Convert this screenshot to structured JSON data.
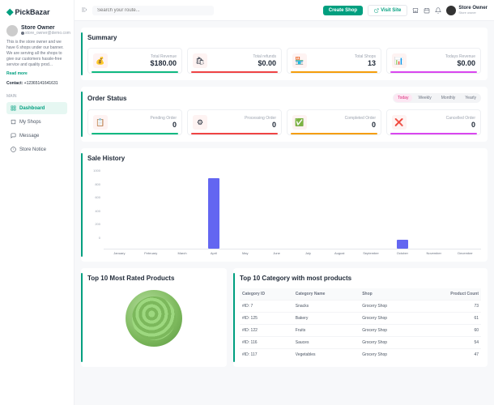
{
  "brand": "PickBazar",
  "search_placeholder": "Search your route...",
  "buttons": {
    "create": "Create Shop",
    "visit": "Visit Site"
  },
  "user": {
    "name": "Store Owner",
    "role": "Store owner"
  },
  "owner": {
    "name": "Store Owner",
    "email": "store_owner@demo.com",
    "bio": "This is the store owner and we have 6 shops under our banner. We are serving all the shops to give our customers hassle-free service and quality prod...",
    "readmore": "Read more",
    "contact_label": "Contact:",
    "contact": "+12365141641631"
  },
  "nav_label": "MAIN",
  "nav": [
    {
      "label": "Dashboard",
      "active": true
    },
    {
      "label": "My Shops"
    },
    {
      "label": "Message"
    },
    {
      "label": "Store Notice"
    }
  ],
  "summary": {
    "title": "Summary",
    "items": [
      {
        "label": "Total Revenue",
        "value": "$180.00",
        "icon": "💰"
      },
      {
        "label": "Total refunds",
        "value": "$0.00",
        "icon": "🛍"
      },
      {
        "label": "Total Shops",
        "value": "13",
        "icon": "🏪"
      },
      {
        "label": "Todays Revenue",
        "value": "$0.00",
        "icon": "📊"
      }
    ]
  },
  "order_status": {
    "title": "Order Status",
    "tabs": [
      "Today",
      "Weekly",
      "Monthly",
      "Yearly"
    ],
    "active_tab": 0,
    "items": [
      {
        "label": "Pending Order",
        "value": "0",
        "icon": "📋"
      },
      {
        "label": "Processing Order",
        "value": "0",
        "icon": "⚙"
      },
      {
        "label": "Completed Order",
        "value": "0",
        "icon": "✅"
      },
      {
        "label": "Cancelled Order",
        "value": "0",
        "icon": "❌"
      }
    ]
  },
  "chart_data": {
    "type": "bar",
    "title": "Sale History",
    "categories": [
      "January",
      "February",
      "March",
      "April",
      "May",
      "June",
      "July",
      "August",
      "September",
      "October",
      "November",
      "December"
    ],
    "values": [
      0,
      0,
      0,
      1000,
      0,
      0,
      0,
      0,
      0,
      120,
      0,
      0
    ],
    "ylim": [
      0,
      1000
    ],
    "yticks": [
      0,
      200,
      400,
      600,
      800,
      1000
    ],
    "xlabel": "",
    "ylabel": ""
  },
  "top_products": {
    "title": "Top 10 Most Rated Products"
  },
  "top_categories": {
    "title": "Top 10 Category with most products",
    "headers": [
      "Category ID",
      "Category Name",
      "Shop",
      "Product Count"
    ],
    "rows": [
      [
        "#ID: 7",
        "Snacks",
        "Grocery Shop",
        "73"
      ],
      [
        "#ID: 125",
        "Bakery",
        "Grocery Shop",
        "61"
      ],
      [
        "#ID: 122",
        "Fruits",
        "Grocery Shop",
        "60"
      ],
      [
        "#ID: 116",
        "Sauces",
        "Grocery Shop",
        "54"
      ],
      [
        "#ID: 117",
        "Vegetables",
        "Grocery Shop",
        "47"
      ]
    ]
  }
}
